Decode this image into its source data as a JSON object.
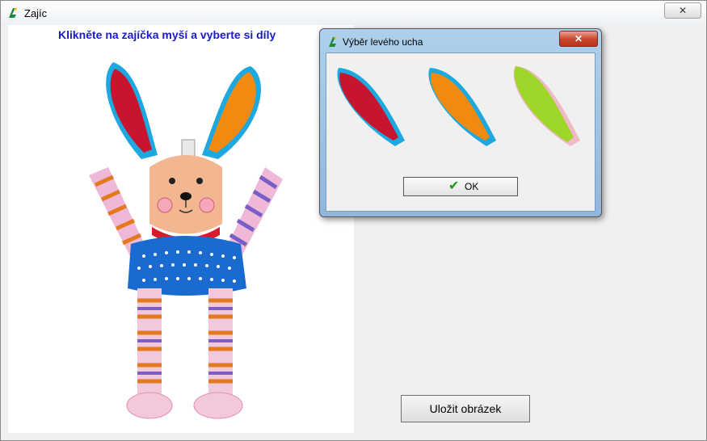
{
  "window": {
    "title": "Zajíc",
    "close_label": "✕"
  },
  "main": {
    "instruction": "Klikněte na zajíčka myší a vyberte  si díly",
    "save_label": "Uložit obrázek"
  },
  "dialog": {
    "title": "Výběr levého ucha",
    "close_label": "✕",
    "ok_label": "OK",
    "options": [
      {
        "name": "red-ear",
        "color": "#c8142e",
        "trim": "#1ea8e0"
      },
      {
        "name": "orange-ear",
        "color": "#f08a10",
        "trim": "#1ea8e0"
      },
      {
        "name": "green-ear",
        "color": "#9ed62a",
        "trim": "#f2b8c8"
      }
    ]
  },
  "icons": {
    "app": "bunny-app-icon",
    "ok": "checkmark-icon"
  },
  "colors": {
    "heading": "#1a1acd",
    "dialog_frame": "#9cc2e5",
    "close_red": "#c9432c"
  }
}
